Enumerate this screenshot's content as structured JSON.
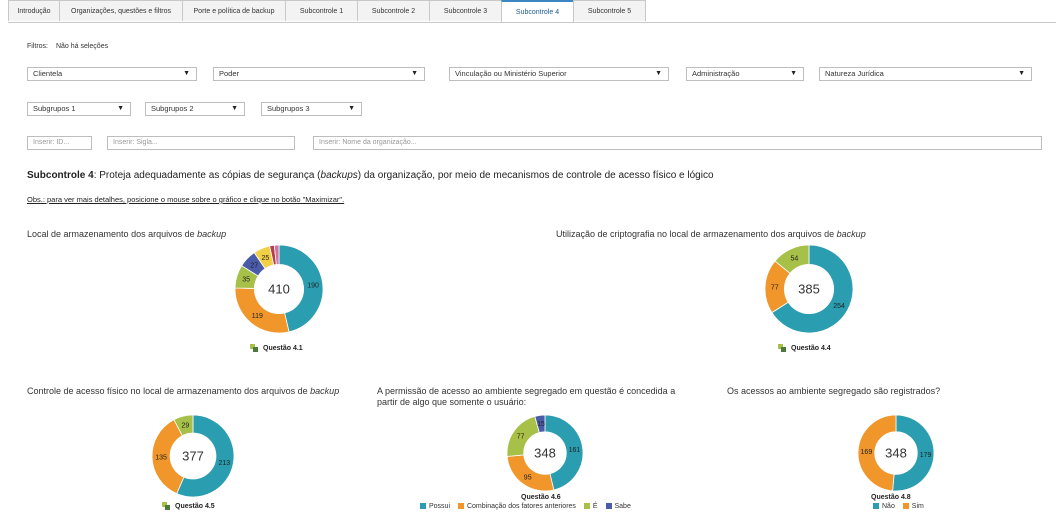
{
  "tabs": [
    {
      "label": "Introdução",
      "width": 52,
      "active": false
    },
    {
      "label": "Organizações, questões e filtros",
      "width": 124,
      "active": false
    },
    {
      "label": "Porte e política de backup",
      "width": 104,
      "active": false
    },
    {
      "label": "Subcontrole 1",
      "width": 73,
      "active": false
    },
    {
      "label": "Subcontrole 2",
      "width": 73,
      "active": false
    },
    {
      "label": "Subcontrole 3",
      "width": 73,
      "active": false
    },
    {
      "label": "Subcontrole 4",
      "width": 73,
      "active": true
    },
    {
      "label": "Subcontrole 5",
      "width": 73,
      "active": false
    }
  ],
  "filters": {
    "label": "Filtros:",
    "value": "Não há seleções",
    "dropdowns_row1": [
      "Clientela",
      "Poder",
      "Vinculação ou Ministério Superior",
      "Administração",
      "Natureza Jurídica"
    ],
    "dropdowns_row2": [
      "Subgrupos 1",
      "Subgrupos 2",
      "Subgrupos 3"
    ],
    "inputs": {
      "id_placeholder": "Inserir: ID...",
      "sigla_placeholder": "Inserir: Sigla...",
      "nome_placeholder": "Inserir: Nome da organização..."
    },
    "arrow": "▼"
  },
  "subcontrole": {
    "label": "Subcontrole 4",
    "text_before": ": Proteja adequadamente as cópias de segurança (",
    "text_italic": "backups",
    "text_after": ") da organização, por meio de mecanismos de controle de acesso físico e lógico"
  },
  "obs": "Obs.: para ver mais detalhes, posicione o mouse sobre o gráfico e clique no botão \"Maximizar\".",
  "colors": {
    "teal": "#2a9db0",
    "orange": "#f0962a",
    "green": "#a6c048",
    "navy": "#4a5ba8",
    "yellow": "#f2d046",
    "red": "#b5404a",
    "pink": "#d46fa0"
  },
  "charts": {
    "c41": {
      "title_before": "Local de armazenamento dos arquivos de ",
      "title_italic": "backup",
      "total": "410",
      "caption": "Questão 4.1"
    },
    "c44": {
      "title_before": "Utilização de criptografia no local de armazenamento dos arquivos de ",
      "title_italic": "backup",
      "total": "385",
      "caption": "Questão 4.4"
    },
    "c45": {
      "title_before": "Controle de acesso físico no local de armazenamento dos arquivos de ",
      "title_italic": "backup",
      "total": "377",
      "caption": "Questão 4.5"
    },
    "c46": {
      "title": "A permissão de acesso ao ambiente segregado em questão é concedida a partir de algo que somente o usuário:",
      "total": "348",
      "caption": "Questão 4.6",
      "legend": [
        "Possui",
        "Combinação dos fatores anteriores",
        "É",
        "Sabe"
      ]
    },
    "c48": {
      "title": "Os acessos ao ambiente segregado são registrados?",
      "total": "348",
      "caption": "Questão 4.8",
      "legend": [
        "Não",
        "Sim"
      ]
    }
  },
  "chart_data": [
    {
      "type": "pie",
      "id": "c41",
      "values": [
        190,
        119,
        35,
        27,
        25,
        7,
        7
      ],
      "labels": [
        "190",
        "119",
        "35",
        "27",
        "25",
        "",
        ""
      ],
      "colors": [
        "#2a9db0",
        "#f0962a",
        "#a6c048",
        "#4a5ba8",
        "#f2d046",
        "#b5404a",
        "#d46fa0"
      ]
    },
    {
      "type": "pie",
      "id": "c44",
      "values": [
        254,
        77,
        54
      ],
      "labels": [
        "254",
        "77",
        "54"
      ],
      "colors": [
        "#2a9db0",
        "#f0962a",
        "#a6c048"
      ]
    },
    {
      "type": "pie",
      "id": "c45",
      "values": [
        213,
        135,
        29
      ],
      "labels": [
        "213",
        "135",
        "29"
      ],
      "colors": [
        "#2a9db0",
        "#f0962a",
        "#a6c048"
      ]
    },
    {
      "type": "pie",
      "id": "c46",
      "values": [
        161,
        95,
        77,
        15
      ],
      "labels": [
        "161",
        "95",
        "77",
        "15"
      ],
      "colors": [
        "#2a9db0",
        "#f0962a",
        "#a6c048",
        "#4a5ba8"
      ]
    },
    {
      "type": "pie",
      "id": "c48",
      "values": [
        179,
        169
      ],
      "labels": [
        "179",
        "169"
      ],
      "colors": [
        "#2a9db0",
        "#f0962a"
      ]
    }
  ]
}
